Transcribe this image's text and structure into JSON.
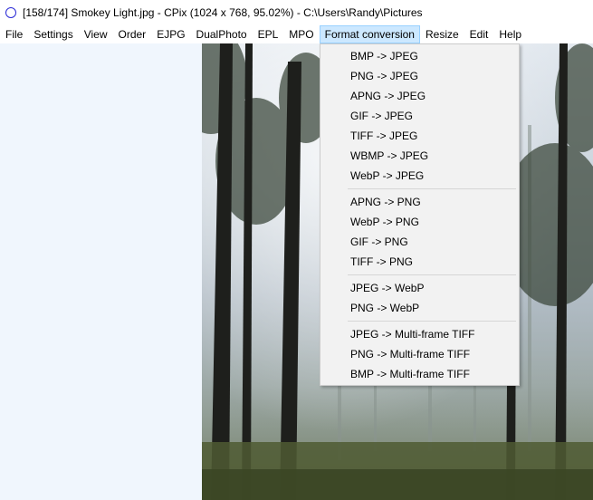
{
  "window": {
    "title": "[158/174] Smokey Light.jpg - CPix (1024 x 768, 95.02%) - C:\\Users\\Randy\\Pictures"
  },
  "menubar": {
    "items": [
      "File",
      "Settings",
      "View",
      "Order",
      "EJPG",
      "DualPhoto",
      "EPL",
      "MPO",
      "Format conversion",
      "Resize",
      "Edit",
      "Help"
    ],
    "active": "Format conversion"
  },
  "format_menu": {
    "groups": [
      [
        "BMP -> JPEG",
        "PNG -> JPEG",
        "APNG -> JPEG",
        "GIF -> JPEG",
        "TIFF -> JPEG",
        "WBMP -> JPEG",
        "WebP -> JPEG"
      ],
      [
        "APNG -> PNG",
        "WebP -> PNG",
        "GIF -> PNG",
        "TIFF -> PNG"
      ],
      [
        "JPEG -> WebP",
        "PNG -> WebP"
      ],
      [
        "JPEG -> Multi-frame TIFF",
        "PNG -> Multi-frame TIFF",
        "BMP -> Multi-frame TIFF"
      ]
    ]
  },
  "colors": {
    "accent_highlight": "#cce8ff",
    "workspace_bg": "#f0f6fd",
    "menu_bg": "#f2f2f2",
    "app_icon": "#2b2bd6"
  }
}
